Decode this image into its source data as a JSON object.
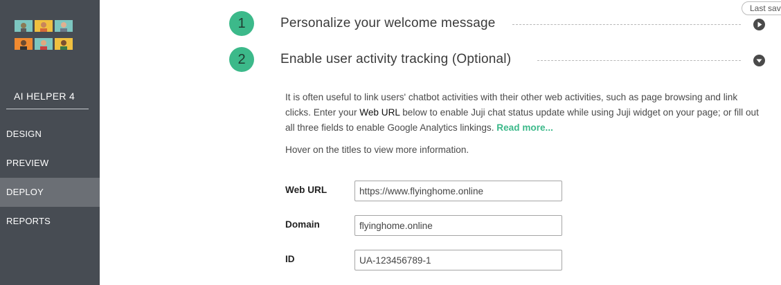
{
  "sidebar": {
    "app_name": "AI HELPER 4",
    "nav": [
      {
        "label": "DESIGN",
        "active": false
      },
      {
        "label": "PREVIEW",
        "active": false
      },
      {
        "label": "DEPLOY",
        "active": true
      },
      {
        "label": "REPORTS",
        "active": false
      }
    ]
  },
  "header": {
    "last_saved_label": "Last sav"
  },
  "steps": [
    {
      "number": "1",
      "title": "Personalize your welcome message",
      "expanded": false,
      "toggle_icon": "play-circle-icon"
    },
    {
      "number": "2",
      "title": "Enable user activity tracking (Optional)",
      "expanded": true,
      "toggle_icon": "chevron-down-circle-icon"
    }
  ],
  "tracking": {
    "desc_part1": "It is often useful to link users' chatbot activities with their other web activities, such as page browsing and link clicks. Enter your ",
    "desc_strong": "Web URL",
    "desc_part2": " below to enable Juji chat status update while using Juji widget on your page; or fill out all three fields to enable Google Analytics linkings. ",
    "read_more": "Read more...",
    "hover_hint": "Hover on the titles to view more information.",
    "fields": {
      "web_url": {
        "label": "Web URL",
        "value": "https://www.flyinghome.online"
      },
      "domain": {
        "label": "Domain",
        "value": "flyinghome.online"
      },
      "id": {
        "label": "ID",
        "value": "UA-123456789-1"
      }
    }
  },
  "colors": {
    "sidebar_bg": "#474c53",
    "sidebar_active": "#6b6f75",
    "accent_green": "#3cb98a"
  }
}
